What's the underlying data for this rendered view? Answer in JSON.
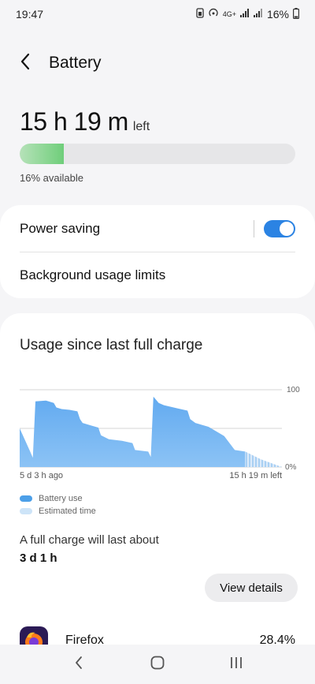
{
  "status_bar": {
    "time": "19:47",
    "network": "4G+",
    "battery_pct": "16%"
  },
  "header": {
    "title": "Battery",
    "back_icon": "chevron-left-icon"
  },
  "summary": {
    "time_left": "15 h 19 m",
    "time_left_suffix": "left",
    "level": 0.16,
    "available_text": "16% available",
    "bar_color": "#6fce7a"
  },
  "settings": {
    "power_saving_label": "Power saving",
    "power_saving_on": true,
    "background_limits_label": "Background usage limits",
    "accent": "#2b83e3"
  },
  "usage": {
    "title": "Usage since last full charge",
    "start_label": "5 d 3 h ago",
    "end_label": "15 h 19 m left",
    "y_labels": [
      "100",
      "0%"
    ],
    "legend": [
      {
        "label": "Battery use",
        "color": "#4c9fe8"
      },
      {
        "label": "Estimated time",
        "color": "#cde4f8"
      }
    ],
    "full_charge_label": "A full charge will last about",
    "full_charge_value": "3 d 1 h",
    "view_details_label": "View details"
  },
  "chart_data": {
    "type": "area",
    "x_start": "5 d 3 h ago",
    "x_end": "15 h 19 m left",
    "ylim": [
      0,
      100
    ],
    "y_ticks": [
      "100",
      "0%"
    ],
    "series": [
      {
        "name": "Battery use",
        "x": [
          0,
          0.02,
          0.04,
          0.05,
          0.06,
          0.1,
          0.13,
          0.14,
          0.16,
          0.19,
          0.22,
          0.23,
          0.24,
          0.27,
          0.3,
          0.31,
          0.34,
          0.39,
          0.43,
          0.44,
          0.49,
          0.5,
          0.51,
          0.53,
          0.55,
          0.6,
          0.64,
          0.65,
          0.67,
          0.72,
          0.77,
          0.78,
          0.82,
          0.86
        ],
        "values": [
          50,
          35,
          20,
          12,
          85,
          86,
          83,
          77,
          75,
          74,
          72,
          62,
          57,
          54,
          51,
          41,
          36,
          34,
          31,
          22,
          20,
          13,
          91,
          83,
          80,
          76,
          73,
          62,
          57,
          52,
          42,
          40,
          22,
          20
        ]
      },
      {
        "name": "Estimated time",
        "x": [
          0.86,
          0.92,
          1.0
        ],
        "values": [
          20,
          10,
          0
        ]
      }
    ]
  },
  "apps": [
    {
      "name": "Firefox",
      "percent": "28.4%"
    }
  ],
  "nav": [
    "back-icon",
    "home-icon",
    "recents-icon"
  ]
}
